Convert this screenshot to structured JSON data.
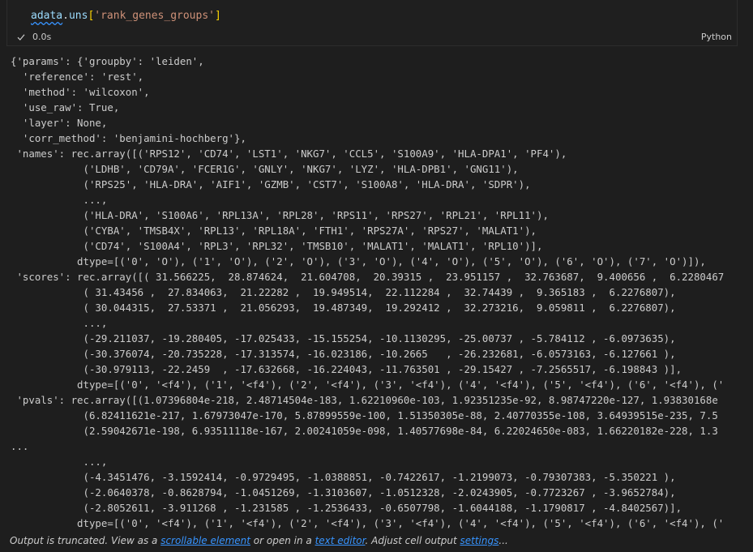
{
  "cell": {
    "code_var": "adata",
    "code_dot": ".",
    "code_attr": "uns",
    "code_open": "[",
    "code_key": "'rank_genes_groups'",
    "code_close": "]",
    "exec_time": "0.0s",
    "language": "Python"
  },
  "output": {
    "lines": [
      "{'params': {'groupby': 'leiden',",
      "  'reference': 'rest',",
      "  'method': 'wilcoxon',",
      "  'use_raw': True,",
      "  'layer': None,",
      "  'corr_method': 'benjamini-hochberg'},",
      " 'names': rec.array([('RPS12', 'CD74', 'LST1', 'NKG7', 'CCL5', 'S100A9', 'HLA-DPA1', 'PF4'),",
      "            ('LDHB', 'CD79A', 'FCER1G', 'GNLY', 'NKG7', 'LYZ', 'HLA-DPB1', 'GNG11'),",
      "            ('RPS25', 'HLA-DRA', 'AIF1', 'GZMB', 'CST7', 'S100A8', 'HLA-DRA', 'SDPR'),",
      "            ...,",
      "            ('HLA-DRA', 'S100A6', 'RPL13A', 'RPL28', 'RPS11', 'RPS27', 'RPL21', 'RPL11'),",
      "            ('CYBA', 'TMSB4X', 'RPL13', 'RPL18A', 'FTH1', 'RPS27A', 'RPS27', 'MALAT1'),",
      "            ('CD74', 'S100A4', 'RPL3', 'RPL32', 'TMSB10', 'MALAT1', 'MALAT1', 'RPL10')],",
      "           dtype=[('0', 'O'), ('1', 'O'), ('2', 'O'), ('3', 'O'), ('4', 'O'), ('5', 'O'), ('6', 'O'), ('7', 'O')]),",
      " 'scores': rec.array([( 31.566225,  28.874624,  21.604708,  20.39315 ,  23.951157 ,  32.763687,  9.400656 ,  6.2280467",
      "            ( 31.43456 ,  27.834063,  21.22282 ,  19.949514,  22.112284 ,  32.74439 ,  9.365183 ,  6.2276807),",
      "            ( 30.044315,  27.53371 ,  21.056293,  19.487349,  19.292412 ,  32.273216,  9.059811 ,  6.2276807),",
      "            ...,",
      "            (-29.211037, -19.280405, -17.025433, -15.155254, -10.1130295, -25.00737 , -5.784112 , -6.0973635),",
      "            (-30.376074, -20.735228, -17.313574, -16.023186, -10.2665   , -26.232681, -6.0573163, -6.127661 ),",
      "            (-30.979113, -22.2459  , -17.632668, -16.224043, -11.763501 , -29.15427 , -7.2565517, -6.198843 )],",
      "           dtype=[('0', '<f4'), ('1', '<f4'), ('2', '<f4'), ('3', '<f4'), ('4', '<f4'), ('5', '<f4'), ('6', '<f4'), ('",
      " 'pvals': rec.array([(1.07396804e-218, 2.48714504e-183, 1.62210960e-103, 1.92351235e-92, 8.98747220e-127, 1.93830168e",
      "            (6.82411621e-217, 1.67973047e-170, 5.87899559e-100, 1.51350305e-88, 2.40770355e-108, 3.64939515e-235, 7.5",
      "            (2.59042671e-198, 6.93511118e-167, 2.00241059e-098, 1.40577698e-84, 6.22024650e-083, 1.66220182e-228, 1.3",
      "...",
      "            ...,",
      "            (-4.3451476, -3.1592414, -0.9729495, -1.0388851, -0.7422617, -1.2199073, -0.79307383, -5.350221 ),",
      "            (-2.0640378, -0.8628794, -1.0451269, -1.3103607, -1.0512328, -2.0243905, -0.7723267 , -3.9652784),",
      "            (-2.8052611, -3.911268 , -1.231585 , -1.2536433, -0.6507798, -1.6044188, -1.1790817 , -4.8402567)],",
      "           dtype=[('0', '<f4'), ('1', '<f4'), ('2', '<f4'), ('3', '<f4'), ('4', '<f4'), ('5', '<f4'), ('6', '<f4'), ('"
    ]
  },
  "footer": {
    "prefix": "Output is truncated. View as a ",
    "link_scrollable": "scrollable element",
    "middle": " or open in a ",
    "link_editor": "text editor",
    "suffix": ". Adjust cell output ",
    "link_settings": "settings",
    "ellipsis": "..."
  }
}
